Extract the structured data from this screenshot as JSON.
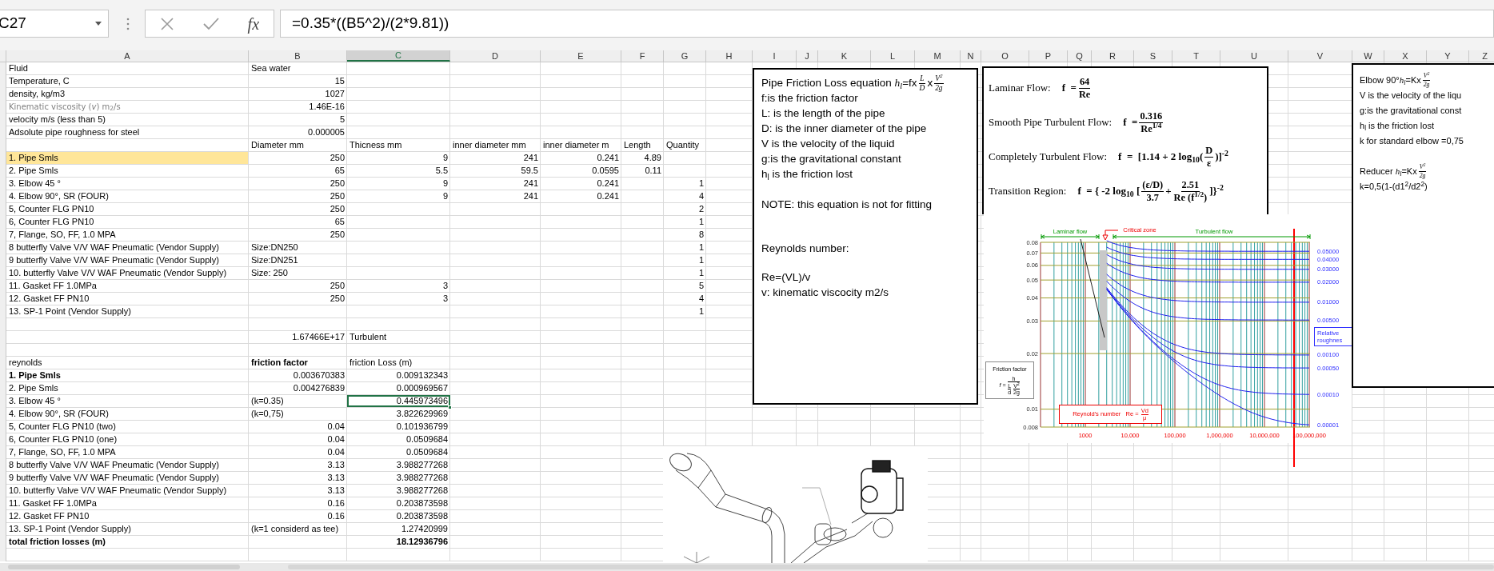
{
  "formula_bar": {
    "name_box": "C27",
    "function_label": "fx",
    "formula": "=0.35*((B5^2)/(2*9.81))"
  },
  "columns": [
    {
      "label": "A",
      "selected": false
    },
    {
      "label": "B",
      "selected": false
    },
    {
      "label": "C",
      "selected": true
    },
    {
      "label": "D",
      "selected": false
    },
    {
      "label": "E",
      "selected": false
    },
    {
      "label": "F",
      "selected": false
    },
    {
      "label": "G",
      "selected": false
    },
    {
      "label": "H",
      "selected": false
    },
    {
      "label": "I",
      "selected": false
    },
    {
      "label": "J",
      "selected": false
    },
    {
      "label": "K",
      "selected": false
    },
    {
      "label": "L",
      "selected": false
    },
    {
      "label": "M",
      "selected": false
    },
    {
      "label": "N",
      "selected": false
    },
    {
      "label": "O",
      "selected": false
    },
    {
      "label": "P",
      "selected": false
    },
    {
      "label": "Q",
      "selected": false
    },
    {
      "label": "R",
      "selected": false
    },
    {
      "label": "S",
      "selected": false
    },
    {
      "label": "T",
      "selected": false
    },
    {
      "label": "U",
      "selected": false
    },
    {
      "label": "V",
      "selected": false
    },
    {
      "label": "W",
      "selected": false
    },
    {
      "label": "X",
      "selected": false
    },
    {
      "label": "Y",
      "selected": false
    },
    {
      "label": "Z",
      "selected": false
    }
  ],
  "rows": [
    {
      "cells": [
        {
          "text": "Fluid",
          "kind": "text",
          "selected": false
        },
        {
          "text": "Sea water",
          "kind": "text",
          "selected": false
        }
      ]
    },
    {
      "cells": [
        {
          "text": "Temperature, C",
          "kind": "text",
          "selected": false
        },
        {
          "text": "15",
          "kind": "num",
          "selected": false
        }
      ]
    },
    {
      "cells": [
        {
          "text": "density, kg/m3",
          "kind": "text",
          "selected": false
        },
        {
          "text": "1027",
          "kind": "num",
          "selected": false
        }
      ]
    },
    {
      "cells": [
        {
          "text": "Kinematic viscosity (*v*)   m$_{2}$/s",
          "kind": "text",
          "muted": true,
          "selected": false
        },
        {
          "text": "1.46E-16",
          "kind": "num",
          "selected": false
        }
      ]
    },
    {
      "cells": [
        {
          "text": "velocity m/s (less than 5)",
          "kind": "text",
          "selected": false
        },
        {
          "text": "5",
          "kind": "num",
          "selected": false
        }
      ]
    },
    {
      "cells": [
        {
          "text": "Adsolute pipe roughness for steel",
          "kind": "text",
          "selected": false
        },
        {
          "text": "0.000005",
          "kind": "num",
          "selected": false
        }
      ]
    },
    {
      "cells": [
        null,
        {
          "text": "Diameter mm",
          "kind": "text",
          "selected": false
        },
        {
          "text": "Thicness mm",
          "kind": "text",
          "selected": false
        },
        {
          "text": "inner diameter mm",
          "kind": "text",
          "selected": false
        },
        {
          "text": "inner diameter m",
          "kind": "text",
          "selected": false
        },
        {
          "text": "Length",
          "kind": "text",
          "selected": false
        },
        {
          "text": "Quantity",
          "kind": "text",
          "selected": false
        }
      ]
    },
    {
      "cells": [
        {
          "text": "1. Pipe Smls",
          "kind": "text",
          "highlighted": true,
          "selected": false
        },
        {
          "text": "250",
          "kind": "num",
          "selected": false
        },
        {
          "text": "9",
          "kind": "num",
          "selected": false
        },
        {
          "text": "241",
          "kind": "num",
          "selected": false
        },
        {
          "text": "0.241",
          "kind": "num",
          "selected": false
        },
        {
          "text": "4.89",
          "kind": "num",
          "selected": false
        }
      ]
    },
    {
      "cells": [
        {
          "text": "2. Pipe Smls",
          "kind": "text",
          "selected": false
        },
        {
          "text": "65",
          "kind": "num",
          "selected": false
        },
        {
          "text": "5.5",
          "kind": "num",
          "selected": false
        },
        {
          "text": "59.5",
          "kind": "num",
          "selected": false
        },
        {
          "text": "0.0595",
          "kind": "num",
          "selected": false
        },
        {
          "text": "0.11",
          "kind": "num",
          "selected": false
        }
      ]
    },
    {
      "cells": [
        {
          "text": "3. Elbow 45 °",
          "kind": "text",
          "selected": false
        },
        {
          "text": "250",
          "kind": "num",
          "selected": false
        },
        {
          "text": "9",
          "kind": "num",
          "selected": false
        },
        {
          "text": "241",
          "kind": "num",
          "selected": false
        },
        {
          "text": "0.241",
          "kind": "num",
          "selected": false
        },
        null,
        {
          "text": "1",
          "kind": "num",
          "selected": false
        }
      ]
    },
    {
      "cells": [
        {
          "text": "4. Elbow 90°, SR (FOUR)",
          "kind": "text",
          "selected": false
        },
        {
          "text": "250",
          "kind": "num",
          "selected": false
        },
        {
          "text": "9",
          "kind": "num",
          "selected": false
        },
        {
          "text": "241",
          "kind": "num",
          "selected": false
        },
        {
          "text": "0.241",
          "kind": "num",
          "selected": false
        },
        null,
        {
          "text": "4",
          "kind": "num",
          "selected": false
        }
      ]
    },
    {
      "cells": [
        {
          "text": "5, Counter FLG PN10",
          "kind": "text",
          "selected": false
        },
        {
          "text": "250",
          "kind": "num",
          "selected": false
        },
        null,
        null,
        null,
        null,
        {
          "text": "2",
          "kind": "num",
          "selected": false
        }
      ]
    },
    {
      "cells": [
        {
          "text": "6, Counter FLG PN10",
          "kind": "text",
          "selected": false
        },
        {
          "text": "65",
          "kind": "num",
          "selected": false
        },
        null,
        null,
        null,
        null,
        {
          "text": "1",
          "kind": "num",
          "selected": false
        }
      ]
    },
    {
      "cells": [
        {
          "text": "7, Flange, SO, FF, 1.0 MPA",
          "kind": "text",
          "selected": false
        },
        {
          "text": "250",
          "kind": "num",
          "selected": false
        },
        null,
        null,
        null,
        null,
        {
          "text": "8",
          "kind": "num",
          "selected": false
        }
      ]
    },
    {
      "cells": [
        {
          "text": "8 butterfly Valve V/V WAF Pneumatic (Vendor Supply)",
          "kind": "text",
          "selected": false
        },
        {
          "text": "Size:DN250",
          "kind": "text",
          "selected": false
        },
        null,
        null,
        null,
        null,
        {
          "text": "1",
          "kind": "num",
          "selected": false
        }
      ]
    },
    {
      "cells": [
        {
          "text": "9 butterfly Valve V/V WAF Pneumatic (Vendor Supply)",
          "kind": "text",
          "selected": false
        },
        {
          "text": "Size:DN251",
          "kind": "text",
          "selected": false
        },
        null,
        null,
        null,
        null,
        {
          "text": "1",
          "kind": "num",
          "selected": false
        }
      ]
    },
    {
      "cells": [
        {
          "text": "10. butterfly Valve V/V WAF Pneumatic (Vendor Supply)",
          "kind": "text",
          "selected": false
        },
        {
          "text": "Size: 250",
          "kind": "text",
          "selected": false
        },
        null,
        null,
        null,
        null,
        {
          "text": "1",
          "kind": "num",
          "selected": false
        }
      ]
    },
    {
      "cells": [
        {
          "text": "11. Gasket FF 1.0MPa",
          "kind": "text",
          "selected": false
        },
        {
          "text": "250",
          "kind": "num",
          "selected": false
        },
        {
          "text": "3",
          "kind": "num",
          "selected": false
        },
        null,
        null,
        null,
        {
          "text": "5",
          "kind": "num",
          "selected": false
        }
      ]
    },
    {
      "cells": [
        {
          "text": "12. Gasket FF PN10",
          "kind": "text",
          "selected": false
        },
        {
          "text": "250",
          "kind": "num",
          "selected": false
        },
        {
          "text": "3",
          "kind": "num",
          "selected": false
        },
        null,
        null,
        null,
        {
          "text": "4",
          "kind": "num",
          "selected": false
        }
      ]
    },
    {
      "cells": [
        {
          "text": "13. SP-1 Point (Vendor Supply)",
          "kind": "text",
          "selected": false
        },
        null,
        null,
        null,
        null,
        null,
        {
          "text": "1",
          "kind": "num",
          "selected": false
        }
      ]
    },
    {},
    {
      "cells": [
        null,
        {
          "text": "1.67466E+17",
          "kind": "num",
          "selected": false
        },
        {
          "text": "Turbulent",
          "kind": "text",
          "selected": false
        }
      ]
    },
    {},
    {
      "cells": [
        {
          "text": "reynolds",
          "kind": "text",
          "selected": false
        },
        {
          "text": "friction factor",
          "kind": "text",
          "strong": true,
          "selected": false
        },
        {
          "text": "friction Loss (m)",
          "kind": "text",
          "selected": false
        }
      ]
    },
    {
      "cells": [
        {
          "text": "1. Pipe Smls",
          "kind": "text",
          "strong": true,
          "selected": false
        },
        {
          "text": "0.003670383",
          "kind": "num",
          "selected": false
        },
        {
          "text": "0.009132343",
          "kind": "num",
          "selected": false
        }
      ]
    },
    {
      "cells": [
        {
          "text": "2. Pipe Smls",
          "kind": "text",
          "selected": false
        },
        {
          "text": "0.004276839",
          "kind": "num",
          "selected": false
        },
        {
          "text": "0.000969567",
          "kind": "num",
          "selected": false
        }
      ]
    },
    {
      "cells": [
        {
          "text": "3. Elbow 45 °",
          "kind": "text",
          "selected": false
        },
        {
          "text": "(k=0.35)",
          "kind": "text",
          "selected": false
        },
        {
          "text": "0.445973496",
          "kind": "num",
          "selected": true
        }
      ]
    },
    {
      "cells": [
        {
          "text": "4. Elbow 90°, SR (FOUR)",
          "kind": "text",
          "selected": false
        },
        {
          "text": "(k=0,75)",
          "kind": "text",
          "selected": false
        },
        {
          "text": "3.822629969",
          "kind": "num",
          "selected": false
        }
      ]
    },
    {
      "cells": [
        {
          "text": "5, Counter FLG PN10 (two)",
          "kind": "text",
          "selected": false
        },
        {
          "text": "0.04",
          "kind": "num",
          "selected": false
        },
        {
          "text": "0.101936799",
          "kind": "num",
          "selected": false
        }
      ]
    },
    {
      "cells": [
        {
          "text": "6, Counter FLG PN10 (one)",
          "kind": "text",
          "selected": false
        },
        {
          "text": "0.04",
          "kind": "num",
          "selected": false
        },
        {
          "text": "0.0509684",
          "kind": "num",
          "selected": false
        }
      ]
    },
    {
      "cells": [
        {
          "text": "7, Flange, SO, FF, 1.0 MPA",
          "kind": "text",
          "selected": false
        },
        {
          "text": "0.04",
          "kind": "num",
          "selected": false
        },
        {
          "text": "0.0509684",
          "kind": "num",
          "selected": false
        }
      ]
    },
    {
      "cells": [
        {
          "text": "8 butterfly Valve V/V WAF Pneumatic (Vendor Supply)",
          "kind": "text",
          "selected": false
        },
        {
          "text": "3.13",
          "kind": "num",
          "selected": false
        },
        {
          "text": "3.988277268",
          "kind": "num",
          "selected": false
        }
      ]
    },
    {
      "cells": [
        {
          "text": "9 butterfly Valve V/V WAF Pneumatic (Vendor Supply)",
          "kind": "text",
          "selected": false
        },
        {
          "text": "3.13",
          "kind": "num",
          "selected": false
        },
        {
          "text": "3.988277268",
          "kind": "num",
          "selected": false
        }
      ]
    },
    {
      "cells": [
        {
          "text": "10. butterfly Valve V/V WAF Pneumatic (Vendor Supply)",
          "kind": "text",
          "selected": false
        },
        {
          "text": "3.13",
          "kind": "num",
          "selected": false
        },
        {
          "text": "3.988277268",
          "kind": "num",
          "selected": false
        }
      ]
    },
    {
      "cells": [
        {
          "text": "11. Gasket FF 1.0MPa",
          "kind": "text",
          "selected": false
        },
        {
          "text": "0.16",
          "kind": "num",
          "selected": false
        },
        {
          "text": "0.203873598",
          "kind": "num",
          "selected": false
        }
      ]
    },
    {
      "cells": [
        {
          "text": "12. Gasket FF PN10",
          "kind": "text",
          "selected": false
        },
        {
          "text": "0.16",
          "kind": "num",
          "selected": false
        },
        {
          "text": "0.203873598",
          "kind": "num",
          "selected": false
        }
      ]
    },
    {
      "cells": [
        {
          "text": "13. SP-1 Point (Vendor Supply)",
          "kind": "text",
          "selected": false
        },
        {
          "text": "(k=1 considerd as tee)",
          "kind": "text",
          "selected": false
        },
        {
          "text": "1.27420999",
          "kind": "num",
          "selected": false
        }
      ]
    },
    {
      "cells": [
        {
          "text": "total friction losses (m)",
          "kind": "text",
          "strong": true,
          "selected": false
        },
        null,
        {
          "text": "18.12936796",
          "kind": "num",
          "strong": true,
          "selected": false
        }
      ]
    },
    {}
  ],
  "friction_textbox": {
    "blocks": [
      [
        {
          "tokens": [
            {
              "kind": "text",
              "text": "Pipe Friction Loss equation "
            },
            {
              "kind": "math",
              "text": "h$_{l}$"
            },
            {
              "kind": "text",
              "text": "=fx"
            },
            {
              "kind": "frac",
              "num": "L",
              "den": "D"
            },
            {
              "kind": "text",
              "text": "x"
            },
            {
              "kind": "frac",
              "num": "V$^{2}$",
              "den": "2g"
            }
          ]
        },
        {
          "tokens": [
            {
              "kind": "text",
              "text": "f:is the friction factor"
            }
          ]
        },
        {
          "tokens": [
            {
              "kind": "text",
              "text": "L: is the length of the pipe"
            }
          ]
        },
        {
          "tokens": [
            {
              "kind": "text",
              "text": "D: is the inner diameter of the pipe"
            }
          ]
        },
        {
          "tokens": [
            {
              "kind": "text",
              "text": "V is the velocity of the liquid"
            }
          ]
        },
        {
          "tokens": [
            {
              "kind": "text",
              "text": "g:is the gravitational constant"
            }
          ]
        },
        {
          "tokens": [
            {
              "kind": "text",
              "text": "h$_{l}$ is the friction lost"
            }
          ]
        }
      ],
      [
        {
          "tokens": [
            {
              "kind": "text",
              "text": "NOTE: this equation is not for fitting"
            }
          ]
        }
      ],
      [
        {
          "tokens": [
            {
              "kind": "text",
              "text": "Reynolds number:"
            }
          ]
        }
      ],
      [
        {
          "tokens": [
            {
              "kind": "text",
              "text": "Re=(VL)/v"
            }
          ]
        },
        {
          "tokens": [
            {
              "kind": "text",
              "text": "v: kinematic viscocity m2/s"
            }
          ]
        }
      ]
    ]
  },
  "flow_formulas": [
    {
      "label": "Laminar Flow:",
      "formula": [
        {
          "kind": "text",
          "text": "f  ="
        },
        {
          "kind": "frac",
          "num": "64",
          "den": "Re"
        }
      ]
    },
    {
      "label": "Smooth Pipe Turbulent Flow:",
      "formula": [
        {
          "kind": "text",
          "text": "f  ="
        },
        {
          "kind": "frac",
          "num": "0.316",
          "den": "Re$^{1/4}$"
        }
      ]
    },
    {
      "label": "Completely Turbulent Flow:",
      "formula": [
        {
          "kind": "text",
          "text": "f  =  [1.14 + 2 log$_{10}$("
        },
        {
          "kind": "frac",
          "num": "D",
          "den": "ε"
        },
        {
          "kind": "text",
          "text": ")]$^{-2}$"
        }
      ]
    },
    {
      "label": "Transition Region:",
      "formula": [
        {
          "kind": "text",
          "text": "f  = { -2 log$_{10}$ ["
        },
        {
          "kind": "frac",
          "num": "(ε/D)",
          "den": "3.7"
        },
        {
          "kind": "text",
          "text": "+"
        },
        {
          "kind": "frac",
          "num": "2.51",
          "den": "Re (f$^{1/2}$)"
        },
        {
          "kind": "text",
          "text": "]}$^{-2}$"
        }
      ]
    }
  ],
  "moody_diagram": {
    "zones": [
      {
        "label": "Laminar flow",
        "kind": "laminar"
      },
      {
        "label": "Critical zone",
        "kind": "critical"
      },
      {
        "label": "Turbulent flow",
        "kind": "turbulent"
      }
    ],
    "y_ticks": [
      "0.08",
      "0.07",
      "0.06",
      "0.05",
      "0.04",
      "0.03",
      "0.02",
      "0.01",
      "0.008"
    ],
    "x_ticks": [
      "1000",
      "10,000",
      "100,000",
      "1,000,000",
      "10,000,000",
      "100,000,000"
    ],
    "roughness": [
      "0.05000",
      "0.04000",
      "0.03000",
      "0.02000",
      "0.01000",
      "0.00500",
      "0.00100",
      "0.00050",
      "0.00010",
      "0.00001"
    ],
    "roughness_title": "Relative roughnes",
    "friction_box": {
      "title": "Friction factor",
      "lhs": "f =",
      "num": "h",
      "den": [
        {
          "num": "L",
          "den": "d"
        },
        {
          "num": "V$^{2}$",
          "den": "2g"
        }
      ]
    },
    "reynolds_box": {
      "label": "Reynold's number   Re =",
      "num": "Vd",
      "den": "μ"
    }
  },
  "elbow_textbox": {
    "blocks": [
      [
        {
          "tokens": [
            {
              "kind": "text",
              "text": "Elbow 90°"
            },
            {
              "kind": "math",
              "text": "h$_{l}$"
            },
            {
              "kind": "text",
              "text": "=Kx"
            },
            {
              "kind": "frac",
              "num": "V$^{2}$",
              "den": "2g"
            }
          ]
        },
        {
          "tokens": [
            {
              "kind": "text",
              "text": "V is the velocity of the liqu"
            }
          ]
        },
        {
          "tokens": [
            {
              "kind": "text",
              "text": "g:is the gravitational const"
            }
          ]
        },
        {
          "tokens": [
            {
              "kind": "text",
              "text": "h$_{l}$ is the friction lost"
            }
          ]
        },
        {
          "tokens": [
            {
              "kind": "text",
              "text": "k for standard elbow =0,75"
            }
          ]
        }
      ],
      [
        {
          "tokens": [
            {
              "kind": "text",
              "text": "Reducer "
            },
            {
              "kind": "math",
              "text": "h$_{l}$"
            },
            {
              "kind": "text",
              "text": "=Kx"
            },
            {
              "kind": "frac",
              "num": "V$^{2}$",
              "den": "2g"
            }
          ]
        },
        {
          "tokens": [
            {
              "kind": "text",
              "text": "k=0,5(1-(d1$^{2}$/d2$^{2}$)"
            }
          ]
        }
      ]
    ]
  }
}
